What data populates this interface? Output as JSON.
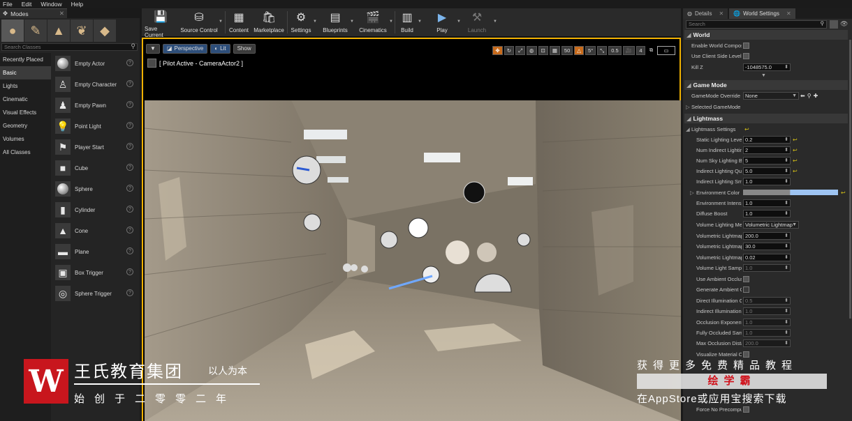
{
  "menu": [
    "File",
    "Edit",
    "Window",
    "Help"
  ],
  "modes": {
    "tab_label": "Modes",
    "search_placeholder": "Search Classes",
    "categories": [
      "Recently Placed",
      "Basic",
      "Lights",
      "Cinematic",
      "Visual Effects",
      "Geometry",
      "Volumes",
      "All Classes"
    ],
    "actors": [
      {
        "label": "Empty Actor",
        "icon": "sphere-icon"
      },
      {
        "label": "Empty Character",
        "icon": "character-icon"
      },
      {
        "label": "Empty Pawn",
        "icon": "pawn-icon"
      },
      {
        "label": "Point Light",
        "icon": "bulb-icon"
      },
      {
        "label": "Player Start",
        "icon": "player-start-icon"
      },
      {
        "label": "Cube",
        "icon": "cube-icon"
      },
      {
        "label": "Sphere",
        "icon": "sphere-icon"
      },
      {
        "label": "Cylinder",
        "icon": "cylinder-icon"
      },
      {
        "label": "Cone",
        "icon": "cone-icon"
      },
      {
        "label": "Plane",
        "icon": "plane-icon"
      },
      {
        "label": "Box Trigger",
        "icon": "box-trigger-icon"
      },
      {
        "label": "Sphere Trigger",
        "icon": "sphere-trigger-icon"
      }
    ]
  },
  "toolbar": {
    "buttons": [
      "Save Current",
      "Source Control",
      "Content",
      "Marketplace",
      "Settings",
      "Blueprints",
      "Cinematics",
      "Build",
      "Play",
      "Launch"
    ]
  },
  "viewport": {
    "perspective": "Perspective",
    "lit": "Lit",
    "show": "Show",
    "pilot": "[ Pilot Active - CameraActor2 ]",
    "grid_snap": "50",
    "rot_snap": "5°",
    "scale_snap": "0.5",
    "camera_speed": "4"
  },
  "right_panel": {
    "tabs": [
      "Details",
      "World Settings"
    ],
    "search_placeholder": "Search",
    "world": {
      "header": "World",
      "enable_world_composition": "Enable World Composi",
      "use_client_side_level": "Use Client Side Level",
      "kill_z_label": "Kill Z",
      "kill_z_value": "-1048575.0"
    },
    "game_mode": {
      "header": "Game Mode",
      "override_label": "GameMode Override",
      "override_value": "None",
      "selected_label": "Selected GameMode"
    },
    "lightmass": {
      "header": "Lightmass",
      "settings_label": "Lightmass Settings",
      "props": [
        {
          "label": "Static Lighting Leve",
          "value": "0.2",
          "reset": true
        },
        {
          "label": "Num Indirect Lightin",
          "value": "2",
          "reset": true
        },
        {
          "label": "Num Sky Lighting Bo",
          "value": "5",
          "reset": true
        },
        {
          "label": "Indirect Lighting Qua",
          "value": "5.0",
          "reset": true
        },
        {
          "label": "Indirect Lighting Sm",
          "value": "1.0",
          "reset": false
        }
      ],
      "env_color_label": "Environment Color",
      "env_intensity": {
        "label": "Environment Intensi",
        "value": "1.0"
      },
      "diffuse_boost": {
        "label": "Diffuse Boost",
        "value": "1.0"
      },
      "volume_method": {
        "label": "Volume Lighting Me",
        "value": "Volumetric Lightmap"
      },
      "vol_props": [
        {
          "label": "Volumetric Lightmap",
          "value": "200.0"
        },
        {
          "label": "Volumetric Lightmap",
          "value": "30.0"
        },
        {
          "label": "Volumetric Lightmap",
          "value": "0.02"
        }
      ],
      "volume_light_samples": {
        "label": "Volume Light Sampl",
        "value": "1.0"
      },
      "use_ambient_occlusion": "Use Ambient Occlus",
      "generate_ambient_occlusion": "Generate Ambient O",
      "ao_props": [
        {
          "label": "Direct Illumination O",
          "value": "0.5"
        },
        {
          "label": "Indirect Illumination",
          "value": "1.0"
        },
        {
          "label": "Occlusion Exponent",
          "value": "1.0"
        },
        {
          "label": "Fully Occluded Sam",
          "value": "1.0"
        },
        {
          "label": "Max Occlusion Dista",
          "value": "200.0"
        }
      ],
      "visualize_material": "Visualize Material O",
      "force_no_precompute": "Force No Precomputed"
    }
  },
  "watermark": {
    "logo_letter": "W",
    "title": "王氏教育集团",
    "slogan": "以人为本",
    "since": "始创于二零零二年",
    "right_line1": "获得更多免费精品教程",
    "right_brand": "绘学霸",
    "right_line3": "在AppStore或应用宝搜索下载"
  }
}
